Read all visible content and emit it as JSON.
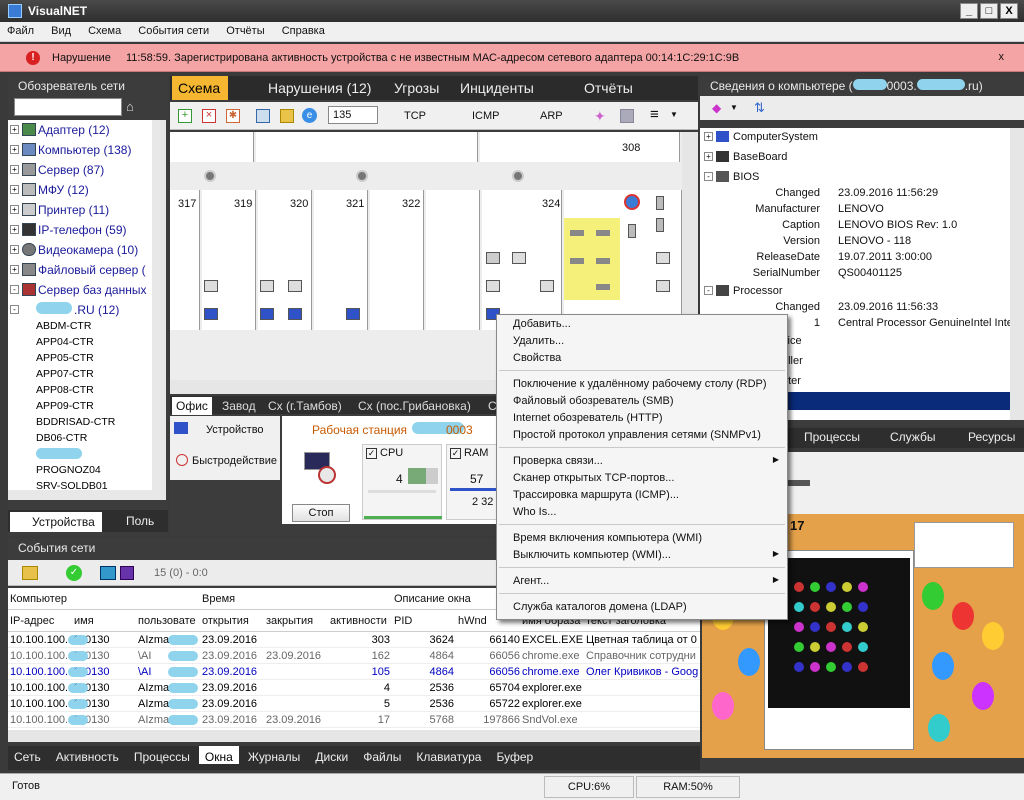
{
  "window": {
    "title": "VisualNET",
    "min": "_",
    "max": "□",
    "close": "X"
  },
  "menu": [
    "Файл",
    "Вид",
    "Схема",
    "События сети",
    "Отчёты",
    "Справка"
  ],
  "alert": {
    "label": "Нарушение",
    "message": "11:58:59. Зарегистрирована активность устройства с не известным МАС-адресом сетевого адаптера 00:14:1C:29:1C:9B",
    "close": "x",
    "color": "#f4a4a4"
  },
  "browser": {
    "title": "Обозреватель сети",
    "categories": [
      {
        "label": "Адаптер (12)",
        "pm": "+"
      },
      {
        "label": "Компьютер (138)",
        "pm": "+"
      },
      {
        "label": "Сервер (87)",
        "pm": "+"
      },
      {
        "label": "МФУ (12)",
        "pm": "+"
      },
      {
        "label": "Принтер (11)",
        "pm": "+"
      },
      {
        "label": "IP-телефон (59)",
        "pm": "+"
      },
      {
        "label": "Видеокамера (10)",
        "pm": "+"
      },
      {
        "label": "Файловый сервер (",
        "pm": "+"
      },
      {
        "label": "Сервер баз данных",
        "pm": "-"
      }
    ],
    "domain": ".RU (12)",
    "hosts": [
      {
        "name": "ABDM-CTR",
        "n": "1"
      },
      {
        "name": "APP04-CTR",
        "n": "1"
      },
      {
        "name": "APP05-CTR",
        "n": "1"
      },
      {
        "name": "APP07-CTR",
        "n": "1"
      },
      {
        "name": "APP08-CTR",
        "n": "1"
      },
      {
        "name": "APP09-CTR",
        "n": "1"
      },
      {
        "name": "BDDRISAD-CTR",
        "n": "1"
      },
      {
        "name": "DB06-CTR",
        "n": "1"
      },
      {
        "name": "PROGNOZ04",
        "n": "1"
      },
      {
        "name": "SRV-SOLDB01",
        "n": "1"
      }
    ],
    "bottom_tabs": [
      "Устройства",
      "Поль"
    ]
  },
  "scheme": {
    "tabs": [
      "Схема",
      "Нарушения (12)",
      "Угрозы",
      "Инциденты",
      "Отчёты"
    ],
    "toolbar": {
      "count": "135",
      "protocols": [
        "TCP",
        "ICMP",
        "ARP"
      ]
    },
    "rooms": [
      "308",
      "317",
      "319",
      "320",
      "321",
      "322",
      "324"
    ],
    "floor_tabs": [
      "Офис",
      "Завод",
      "Сх (г.Тамбов)",
      "Сх (пос.Грибановка)",
      "С"
    ]
  },
  "device": {
    "tabs": [
      "Устройство",
      "Быстродействие"
    ],
    "title": "Рабочая станция",
    "title_suffix": "0003",
    "stop": "Стоп",
    "cpu": {
      "label": "CPU",
      "value": "4"
    },
    "ram": {
      "label": "RAM",
      "value": "57",
      "sub": "2 32"
    }
  },
  "events": {
    "title": "События сети",
    "toolbar_count": "15 (0) - 0:0",
    "group_headers": [
      "Компьютер",
      "Время",
      "Описание окна"
    ],
    "columns": [
      "IP-адрес",
      "имя",
      "пользовате",
      "открытия",
      "закрытия",
      "активности",
      "PID",
      "hWnd",
      "имя образа",
      "текст заголовка"
    ],
    "rows": [
      {
        "ip": "10.100.100.",
        "name": "S-0130",
        "user": "AIzma",
        "open": "23.09.2016",
        "close": "",
        "act": "303",
        "pid": "3624",
        "hwnd": "66140",
        "img": "EXCEL.EXE",
        "text": "Цветная таблица от 0",
        "color": "#000000"
      },
      {
        "ip": "10.100.100.",
        "name": "S-0130",
        "user": "\\AI",
        "open": "23.09.2016",
        "close": "23.09.2016",
        "act": "162",
        "pid": "4864",
        "hwnd": "66056",
        "img": "chrome.exe",
        "text": "Справочник сотрудни",
        "color": "#666666"
      },
      {
        "ip": "10.100.100.",
        "name": "S-0130",
        "user": "\\AI",
        "open": "23.09.2016",
        "close": "",
        "act": "105",
        "pid": "4864",
        "hwnd": "66056",
        "img": "chrome.exe",
        "text": "Олег Кривиков - Goog",
        "color": "#0000c0"
      },
      {
        "ip": "10.100.100.",
        "name": "S-0130",
        "user": "AIzma",
        "open": "23.09.2016",
        "close": "",
        "act": "4",
        "pid": "2536",
        "hwnd": "65704",
        "img": "explorer.exe",
        "text": "",
        "color": "#000000"
      },
      {
        "ip": "10.100.100.",
        "name": "S-0130",
        "user": "AIzma",
        "open": "23.09.2016",
        "close": "",
        "act": "5",
        "pid": "2536",
        "hwnd": "65722",
        "img": "explorer.exe",
        "text": "",
        "color": "#000000"
      },
      {
        "ip": "10.100.100.",
        "name": "S-0130",
        "user": "AIzma",
        "open": "23.09.2016",
        "close": "23.09.2016",
        "act": "17",
        "pid": "5768",
        "hwnd": "197866",
        "img": "SndVol.exe",
        "text": "",
        "color": "#666666"
      }
    ]
  },
  "bottom_tabs": [
    "Сеть",
    "Активность",
    "Процессы",
    "Окна",
    "Журналы",
    "Диски",
    "Файлы",
    "Клавиатура",
    "Буфер"
  ],
  "pcinfo": {
    "title": "Сведения о компьютере (",
    "title_mid": "0003.",
    "title_end": ".ru)",
    "nodes": [
      "ComputerSystem",
      "BaseBoard",
      "BIOS"
    ],
    "bios": [
      {
        "k": "Changed",
        "v": "23.09.2016 11:56:29"
      },
      {
        "k": "Manufacturer",
        "v": "LENOVO"
      },
      {
        "k": "Caption",
        "v": "LENOVO BIOS Rev: 1.0"
      },
      {
        "k": "Version",
        "v": "LENOVO - 118"
      },
      {
        "k": "ReleaseDate",
        "v": "19.07.2011 3:00:00"
      },
      {
        "k": "SerialNumber",
        "v": "QS00401125"
      }
    ],
    "processor": "Processor",
    "proc": [
      {
        "k": "Changed",
        "v": "23.09.2016 11:56:33"
      },
      {
        "k": "1",
        "v": "Central Processor GenuineIntel Inte"
      }
    ],
    "partial": [
      "vice",
      "oller",
      "pter",
      "e"
    ],
    "tabs": [
      "Процессы",
      "Службы",
      "Ресурсы"
    ]
  },
  "context_menu": {
    "groups": [
      [
        {
          "label": "Добавить..."
        },
        {
          "label": "Удалить..."
        },
        {
          "label": "Свойства"
        }
      ],
      [
        {
          "label": "Поключение к удалённому рабочему столу (RDP)"
        },
        {
          "label": "Файловый обозреватель (SMB)"
        },
        {
          "label": "Internet обозреватель (HTTP)"
        },
        {
          "label": "Простой протокол управления сетями (SNMPv1)"
        }
      ],
      [
        {
          "label": "Проверка связи...",
          "sub": true
        },
        {
          "label": "Сканер открытых TCP-портов..."
        },
        {
          "label": "Трассировка маршрута (ICMP)..."
        },
        {
          "label": "Who Is..."
        }
      ],
      [
        {
          "label": "Время включения компьютера (WMI)"
        },
        {
          "label": "Выключить компьютер (WMI)...",
          "sub": true
        }
      ],
      [
        {
          "label": "Агент...",
          "sub": true
        }
      ],
      [
        {
          "label": "Служба каталогов домена (LDAP)"
        }
      ]
    ]
  },
  "preview": {
    "text": "17"
  },
  "status": {
    "ready": "Готов",
    "cpu": "CPU:6%",
    "ram": "RAM:50%"
  }
}
